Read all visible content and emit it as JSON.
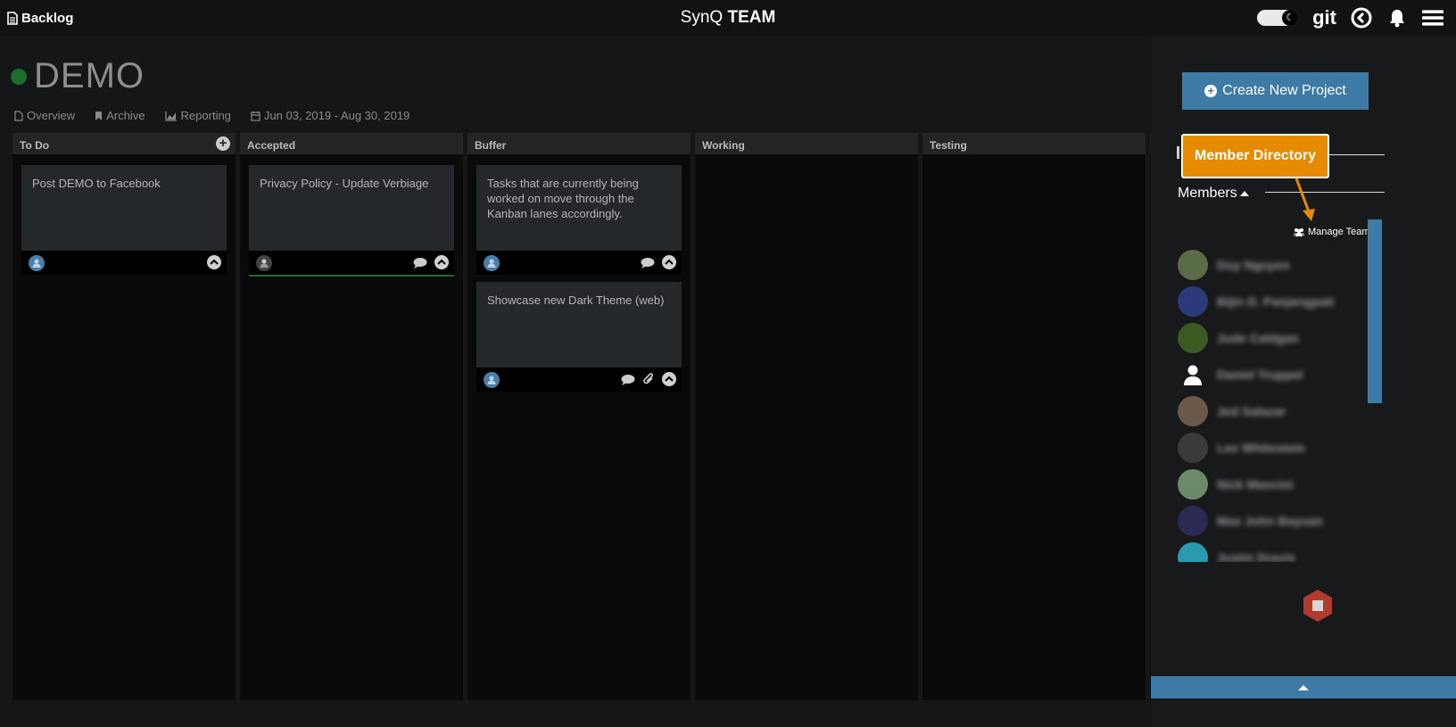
{
  "topbar": {
    "backlog_label": "Backlog",
    "brand_light": "SynQ",
    "brand_bold": "TEAM",
    "git_label": "git"
  },
  "project": {
    "name": "DEMO",
    "status_color": "#1d6d2c",
    "nav": {
      "overview": "Overview",
      "archive": "Archive",
      "reporting": "Reporting",
      "dates": "Jun 03, 2019 - Aug 30, 2019"
    }
  },
  "lanes": [
    {
      "title": "To Do"
    },
    {
      "title": "Accepted"
    },
    {
      "title": "Buffer"
    },
    {
      "title": "Working"
    },
    {
      "title": "Testing"
    }
  ],
  "cards": {
    "todo_1": "Post DEMO to Facebook",
    "accepted_1": "Privacy Policy - Update Verbiage",
    "buffer_1": "Tasks that are currently being worked on move through the Kanban lanes accordingly.",
    "buffer_2": "Showcase new Dark Theme (web)"
  },
  "sidebar": {
    "create_project": "Create New Project",
    "member_directory": "Member Directory",
    "members_label": "Members",
    "manage_team": "Manage Team",
    "members": [
      {
        "name": "Duy Nguyen",
        "avatar_color": "#5a6b4a"
      },
      {
        "name": "Bijin D. Panjangpati",
        "avatar_color": "#2b3a7a"
      },
      {
        "name": "Jude Caldgan",
        "avatar_color": "#3b5a22"
      },
      {
        "name": "Daniel Truppel",
        "avatar_color": "#18191a"
      },
      {
        "name": "Jed Salazar",
        "avatar_color": "#6b5848"
      },
      {
        "name": "Lee Whitestein",
        "avatar_color": "#3a3a3a"
      },
      {
        "name": "Nick Mancini",
        "avatar_color": "#6a8a6a"
      },
      {
        "name": "Max John Bayuan",
        "avatar_color": "#2a2a55"
      },
      {
        "name": "Justin Dravis",
        "avatar_color": "#2a9ab0"
      }
    ]
  },
  "colors": {
    "accent": "#3d7ba6",
    "highlight": "#e68a00",
    "stop": "#b03a2e"
  }
}
